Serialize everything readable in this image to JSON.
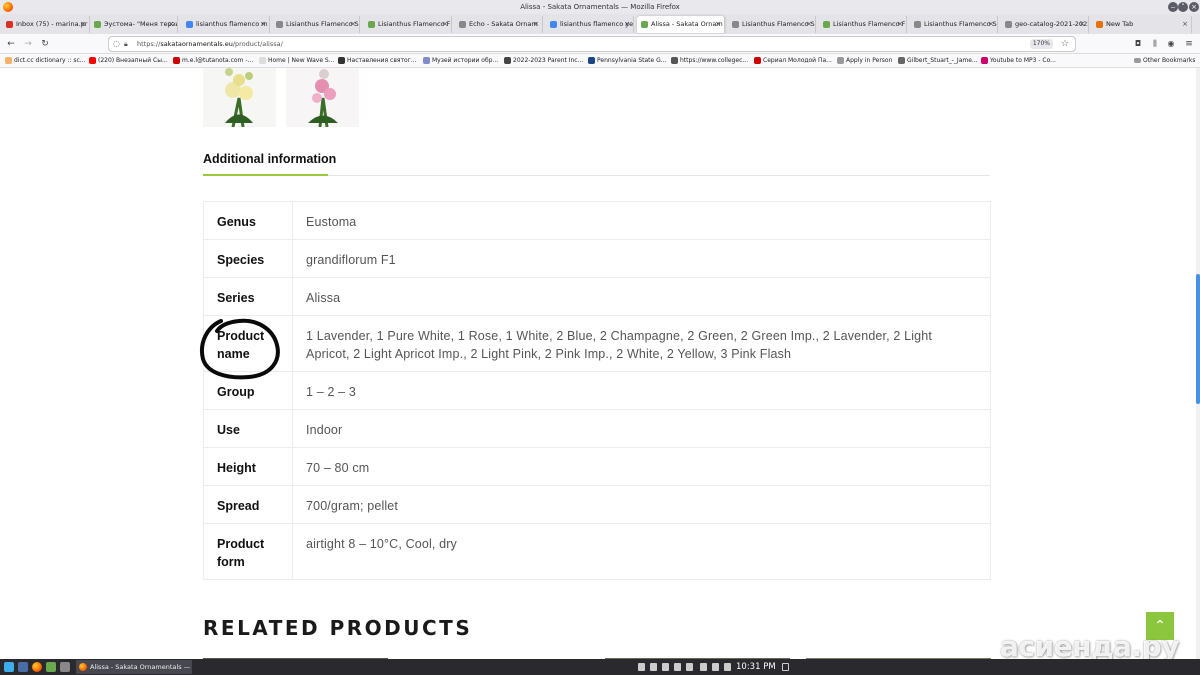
{
  "window": {
    "title": "Alissa - Sakata Ornamentals — Mozilla Firefox"
  },
  "tabs": [
    {
      "label": "Inbox (75) - marina.pr",
      "color": "#d93025"
    },
    {
      "label": "Эустома- \"Меня терзы",
      "color": "#6aa84f"
    },
    {
      "label": "lisianthus flamenco m",
      "color": "#4285f4"
    },
    {
      "label": "Lisianthus Flamenco Seri",
      "color": "#888888"
    },
    {
      "label": "Lisianthus Flamenco F",
      "color": "#6aa84f"
    },
    {
      "label": "Echo - Sakata Ornam",
      "color": "#888888"
    },
    {
      "label": "lisianthus flamenco ye",
      "color": "#4285f4"
    },
    {
      "label": "Alissa - Sakata Ornam",
      "color": "#6aa84f",
      "active": true
    },
    {
      "label": "Lisianthus Flamenco Seri",
      "color": "#888888"
    },
    {
      "label": "Lisianthus Flamenco F",
      "color": "#6aa84f"
    },
    {
      "label": "Lisianthus Flamenco Seri",
      "color": "#888888"
    },
    {
      "label": "geo-catalog-2021-2022-",
      "color": "#888888"
    },
    {
      "label": "New Tab",
      "color": "#e8710a"
    }
  ],
  "navbar": {
    "url_prefix": "https://",
    "url_domain": "sakataornamentals.eu",
    "url_path": "/product/alissa/",
    "zoom": "170%"
  },
  "bookmarks": [
    {
      "label": "dict.cc dictionary :: sc...",
      "color": "#f6b26b"
    },
    {
      "label": "(220) Внезапный Сы...",
      "color": "#ff0000"
    },
    {
      "label": "m.e.l@tutanota.com -...",
      "color": "#cc0000"
    },
    {
      "label": "Home | New Wave S...",
      "color": "#dddddd"
    },
    {
      "label": "Наставления святог...",
      "color": "#333333"
    },
    {
      "label": "Музей истории обр...",
      "color": "#7f8cc7"
    },
    {
      "label": "2022-2023 Parent Inc...",
      "color": "#444444"
    },
    {
      "label": "Pennsylvania State G...",
      "color": "#1c4587"
    },
    {
      "label": "https://www.collegec...",
      "color": "#555555"
    },
    {
      "label": "Сериал Молодой Па...",
      "color": "#cc0000"
    },
    {
      "label": "Apply in Person",
      "color": "#999999"
    },
    {
      "label": "Gilbert_Stuart_-_Jame...",
      "color": "#666666"
    },
    {
      "label": "Youtube to MP3 - Co...",
      "color": "#cc0066"
    }
  ],
  "other_bookmarks": "Other Bookmarks",
  "page": {
    "section_title": "Additional information",
    "rows": [
      {
        "label": "Genus",
        "value": "Eustoma"
      },
      {
        "label": "Species",
        "value": "grandiflorum F1"
      },
      {
        "label": "Series",
        "value": "Alissa"
      },
      {
        "label": "Product name",
        "value": "1 Lavender, 1 Pure White, 1 Rose, 1 White, 2 Blue, 2 Champagne, 2 Green, 2 Green Imp., 2 Lavender, 2 Light Apricot, 2 Light Apricot Imp., 2 Light Pink, 2 Pink Imp., 2 White, 2 Yellow, 3 Pink Flash"
      },
      {
        "label": "Group",
        "value": "1 – 2 – 3"
      },
      {
        "label": "Use",
        "value": "Indoor"
      },
      {
        "label": "Height",
        "value": "70 – 80 cm"
      },
      {
        "label": "Spread",
        "value": "700/gram; pellet"
      },
      {
        "label": "Product form",
        "value": "airtight 8 – 10°C, Cool, dry"
      }
    ],
    "related_title": "RELATED PRODUCTS",
    "accent_color": "#8cc63f"
  },
  "watermark": "асиенда.ру",
  "taskbar": {
    "task_label": "Alissa - Sakata Ornamentals — M...",
    "time": "10:31 PM"
  }
}
